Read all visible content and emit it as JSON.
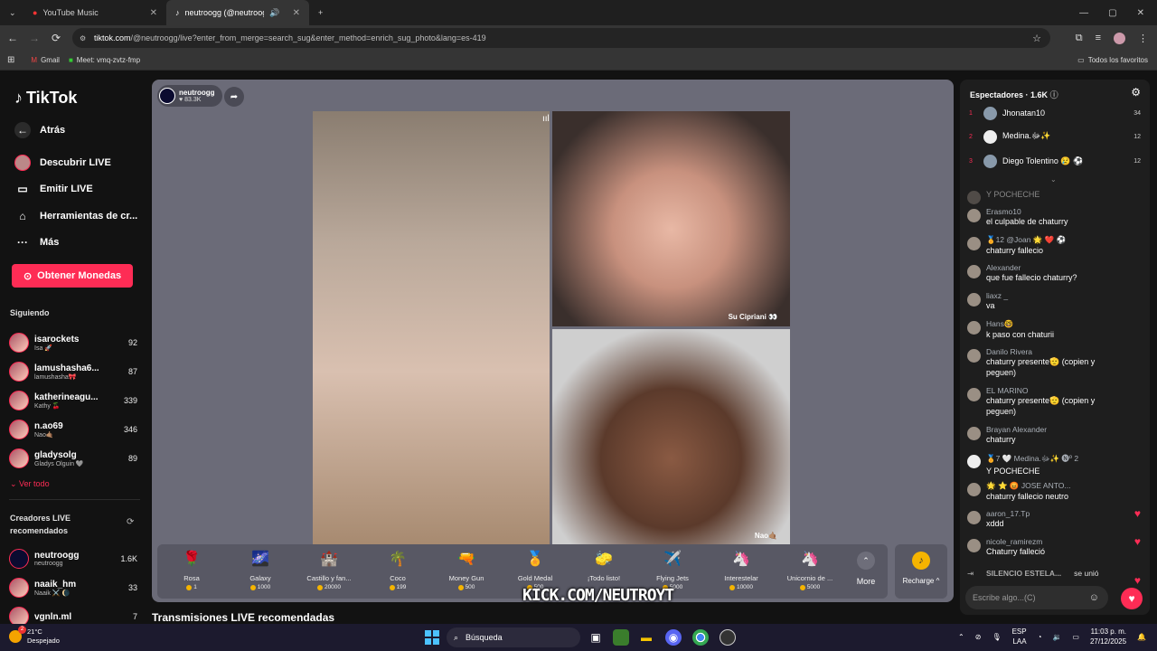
{
  "browser": {
    "tabs": [
      {
        "title": "YouTube Music"
      },
      {
        "title": "neutroogg (@neutroogg) e"
      }
    ],
    "url_host": "tiktok.com",
    "url_path": "/@neutroogg/live?enter_from_merge=search_sug&enter_method=enrich_sug_photo&lang=es-419",
    "bookmarks": [
      "Gmail",
      "Meet: vmq-zvtz-fmp"
    ],
    "all_bookmarks": "Todos los favoritos"
  },
  "sidebar": {
    "logo": "TikTok",
    "menu": [
      {
        "label": "Atrás",
        "icon": "back-arrow-icon"
      },
      {
        "label": "Descubrir LIVE",
        "icon": "live-discover-icon"
      },
      {
        "label": "Emitir LIVE",
        "icon": "camera-icon"
      },
      {
        "label": "Herramientas de cr...",
        "icon": "creator-tools-icon"
      },
      {
        "label": "Más",
        "icon": "more-dots-icon"
      }
    ],
    "coins_button": "Obtener Monedas",
    "following_title": "Siguiendo",
    "following": [
      {
        "name": "isarockets",
        "sub": "Isa 🚀",
        "count": "92"
      },
      {
        "name": "lamushasha6...",
        "sub": "lamushasha🎀",
        "count": "87"
      },
      {
        "name": "katherineagu...",
        "sub": "Kathy 🍒",
        "count": "339"
      },
      {
        "name": "n.ao69",
        "sub": "Nao🤙🏽",
        "count": "346"
      },
      {
        "name": "gladysolg",
        "sub": "Gladys Olguin 🩶",
        "count": "89"
      }
    ],
    "view_all": "Ver todo",
    "recommended_title": "Creadores LIVE recomendados",
    "recommended": [
      {
        "name": "neutroogg",
        "sub": "neutroogg",
        "count": "1.6K"
      },
      {
        "name": "naaik_hm",
        "sub": "Naaik ⚔️ 🌘",
        "count": "33"
      },
      {
        "name": "vgnln.ml",
        "sub": "",
        "count": "7"
      }
    ]
  },
  "stage": {
    "host_name": "neutroogg",
    "host_likes": "83.3K",
    "guest_labels": [
      "Su Cipriani 👀",
      "Nao🤙🏽"
    ],
    "gifts": [
      {
        "name": "Rosa",
        "price": "1",
        "icon": "🌹"
      },
      {
        "name": "Galaxy",
        "price": "1000",
        "icon": "🌌"
      },
      {
        "name": "Castillo y fan...",
        "price": "20000",
        "icon": "🏰"
      },
      {
        "name": "Coco",
        "price": "199",
        "icon": "🌴"
      },
      {
        "name": "Money Gun",
        "price": "500",
        "icon": "🔫"
      },
      {
        "name": "Gold Medal",
        "price": "500",
        "icon": "🏅"
      },
      {
        "name": "¡Todo listo!",
        "price": "",
        "icon": "🧽"
      },
      {
        "name": "Flying Jets",
        "price": "5000",
        "icon": "✈️"
      },
      {
        "name": "Interestelar",
        "price": "10000",
        "icon": "🦄"
      },
      {
        "name": "Unicornio de ...",
        "price": "5000",
        "icon": "🦄"
      }
    ],
    "more_label": "More",
    "recharge_label": "Recharge ^",
    "watermark": "KICK.COM/NEUTROYT",
    "recommended_heading": "Transmisiones LIVE recomendadas"
  },
  "chat": {
    "viewers_title": "Espectadores · 1.6K",
    "top_viewers": [
      {
        "rank": "1",
        "name": "Jhonatan10",
        "score": "34"
      },
      {
        "rank": "2",
        "name": "Medina.ﷻ✨",
        "score": "12"
      },
      {
        "rank": "3",
        "name": "Diego Tolentino 😢 ⚽",
        "score": "12"
      }
    ],
    "messages": [
      {
        "user": "",
        "text": "Y POCHECHE"
      },
      {
        "user": "Erasmo10",
        "text": "el culpable de chaturry"
      },
      {
        "user": "🏅12 @Joan 🌟 ❤️ ⚽",
        "text": "chaturry fallecio"
      },
      {
        "user": "Alexander",
        "text": "que fue fallecio chaturry?"
      },
      {
        "user": "liaxz _",
        "text": "va"
      },
      {
        "user": "Hans🤓",
        "text": "k paso con chaturii"
      },
      {
        "user": "Danilo Rivera",
        "text": "chaturry presente🫡 (copien y peguen)"
      },
      {
        "user": "EL MARINO",
        "text": "chaturry presente🫡 (copien y peguen)"
      },
      {
        "user": "Brayan Alexander",
        "text": "chaturry"
      },
      {
        "user": "🏅7 🤍 Medina.ﷻ✨ 🅝º 2",
        "text": "Y POCHECHE"
      },
      {
        "user": "🌟 ⭐ 😡 JOSE ANTO...",
        "text": "chaturry fallecio neutro"
      },
      {
        "user": "aaron_17.Tp",
        "text": "xddd"
      },
      {
        "user": "nicole_ramirezm",
        "text": "Chaturry falleció"
      }
    ],
    "join_notice_user": "SILENCIO ESTELA...",
    "join_notice_text": "se unió",
    "input_placeholder": "Escribe algo...(C)"
  },
  "taskbar": {
    "temp": "21°C",
    "weather": "Despejado",
    "weather_badge": "2",
    "search": "Búsqueda",
    "lang": "ESP",
    "lang2": "LAA",
    "time": "11:03 p. m.",
    "date": "27/12/2025"
  },
  "colors": {
    "accent": "#fe2c55",
    "coin": "#f5b400",
    "stage_bg": "#6b6b78"
  }
}
